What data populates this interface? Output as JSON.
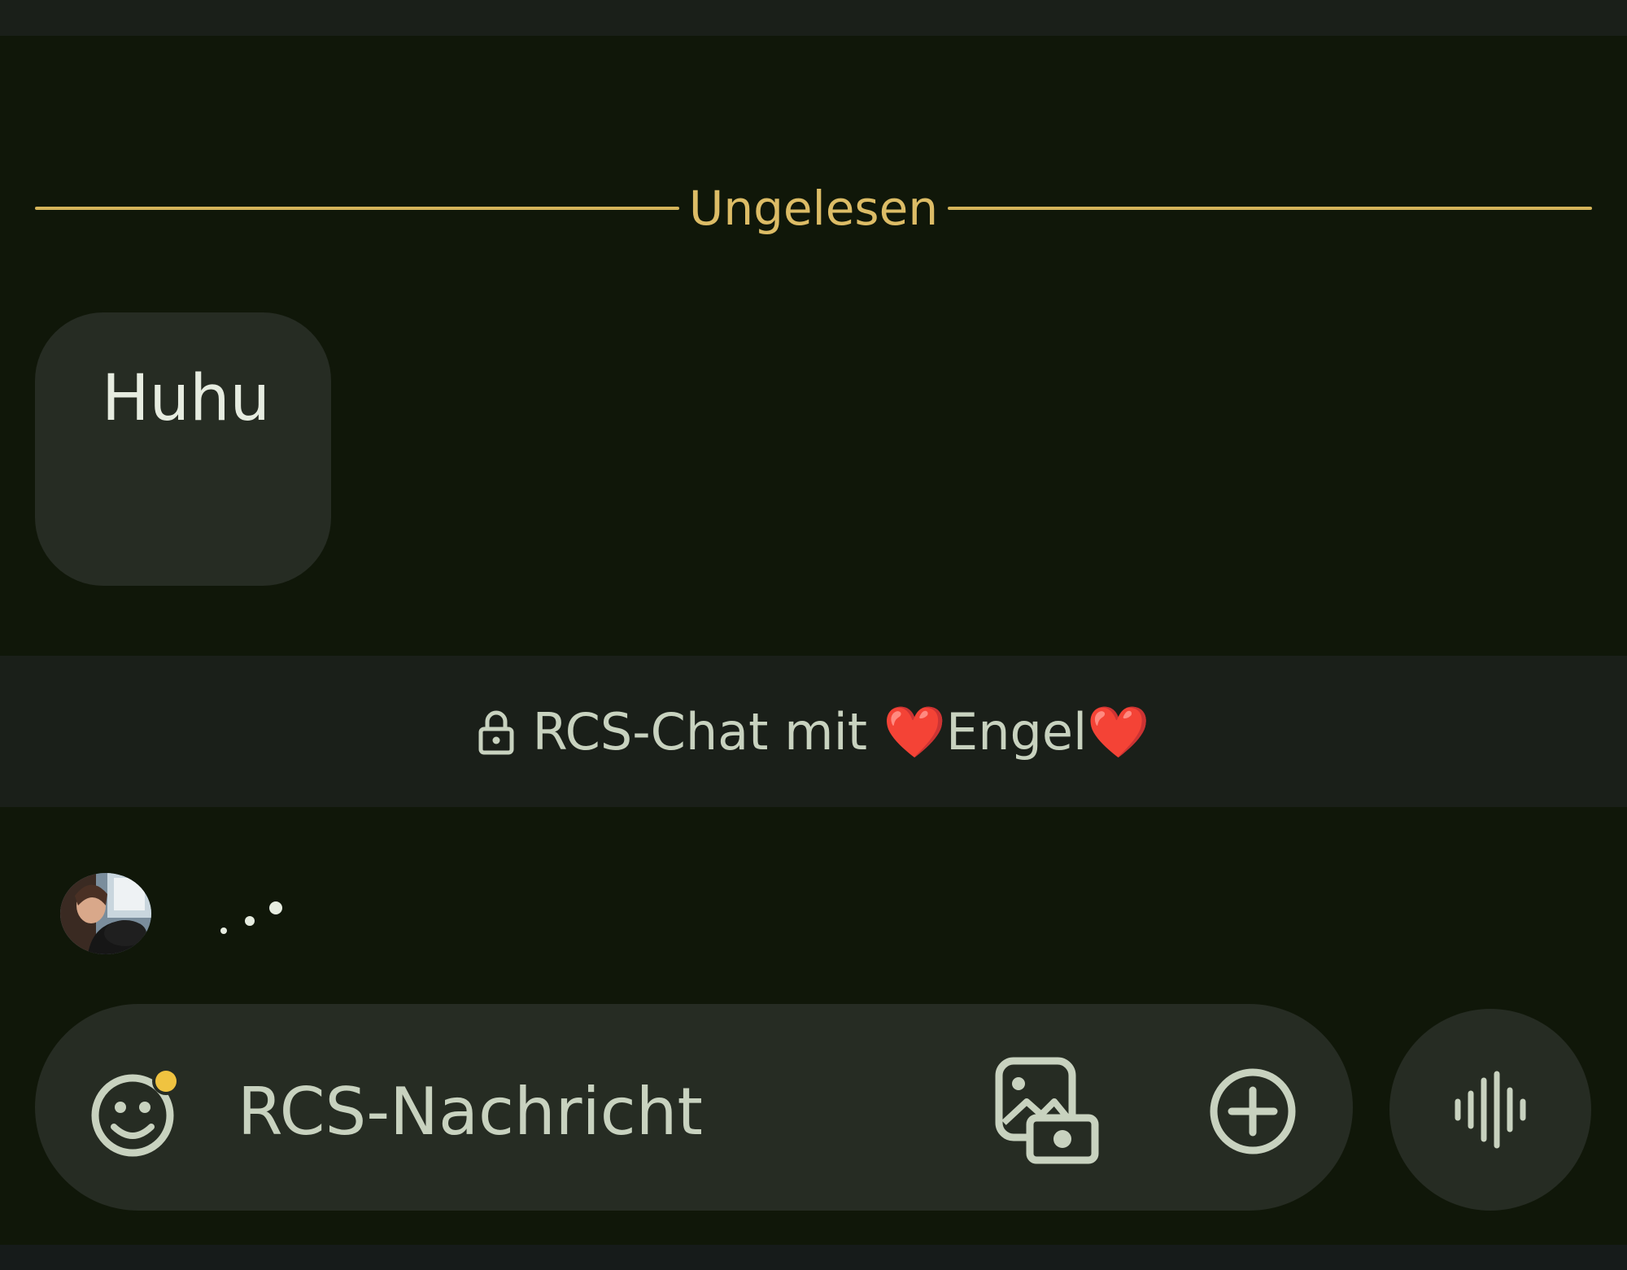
{
  "divider": {
    "label": "Ungelesen",
    "color": "#d4b45a"
  },
  "message": {
    "text": "Huhu"
  },
  "chat_info": {
    "text": "RCS-Chat mit ❤️Engel❤️",
    "icon": "lock-icon"
  },
  "typing_indicator": {
    "icon": "typing-dots-icon"
  },
  "composer": {
    "placeholder": "RCS-Nachricht",
    "value": "",
    "emoji_icon": "emoji-icon",
    "emoji_badge_color": "#f0c340",
    "gallery_icon": "gallery-icon",
    "attach_icon": "plus-circle-icon",
    "voice_icon": "voice-waveform-icon"
  },
  "colors": {
    "background": "#101709",
    "surface": "#262c23",
    "band": "#1a1f19",
    "accent": "#dcbc66",
    "icon": "#c8d2bf"
  }
}
